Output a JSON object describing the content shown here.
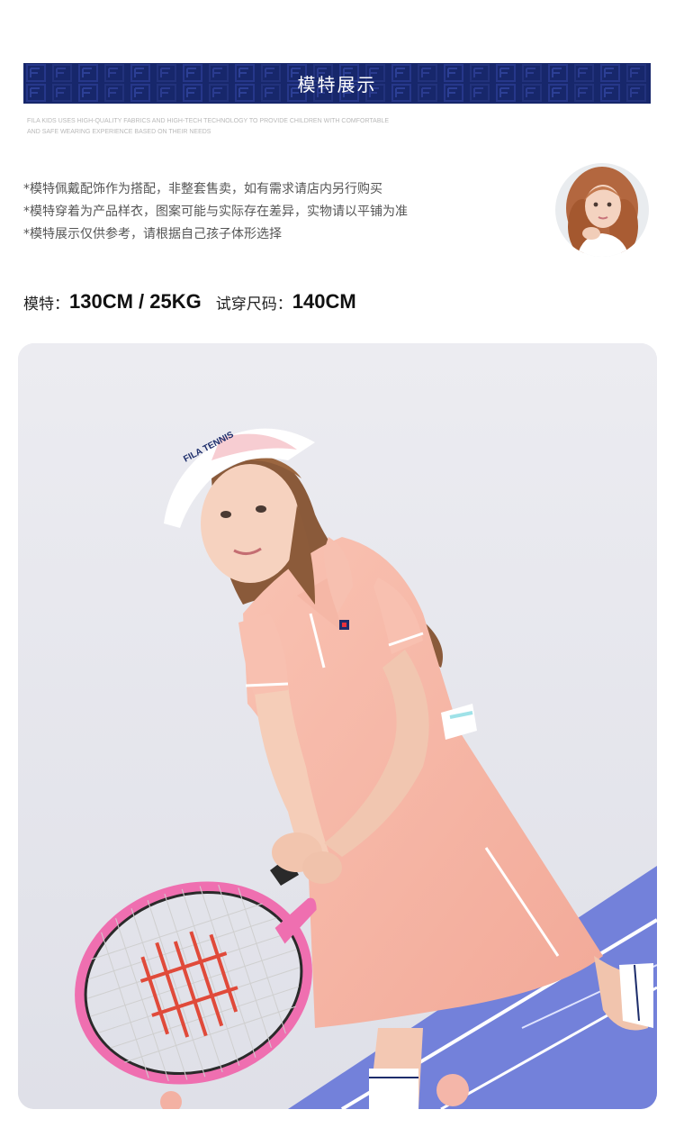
{
  "banner": {
    "title": "模特展示",
    "pattern_logo": "FILA",
    "background_color": "#17276b"
  },
  "subcopy": {
    "line1": "FILA KIDS USES HIGH-QUALITY FABRICS AND HIGH-TECH TECHNOLOGY TO PROVIDE CHILDREN WITH COMFORTABLE",
    "line2": "AND SAFE WEARING EXPERIENCE BASED ON THEIR NEEDS"
  },
  "notes": [
    "*模特佩戴配饰作为搭配，非整套售卖，如有需求请店内另行购买",
    "*模特穿着为产品样衣，图案可能与实际存在差异，实物请以平铺为准",
    "*模特展示仅供参考，请根据自己孩子体形选择"
  ],
  "spec": {
    "model_label": "模特：",
    "model_value": "130CM / 25KG",
    "size_label": "试穿尺码：",
    "size_value": "140CM"
  },
  "photo": {
    "visor_text": "FILA TENNIS",
    "dress_color": "#f6b3a2",
    "racket_color": "#ef6fb0",
    "court_color": "#6f7fd9"
  }
}
